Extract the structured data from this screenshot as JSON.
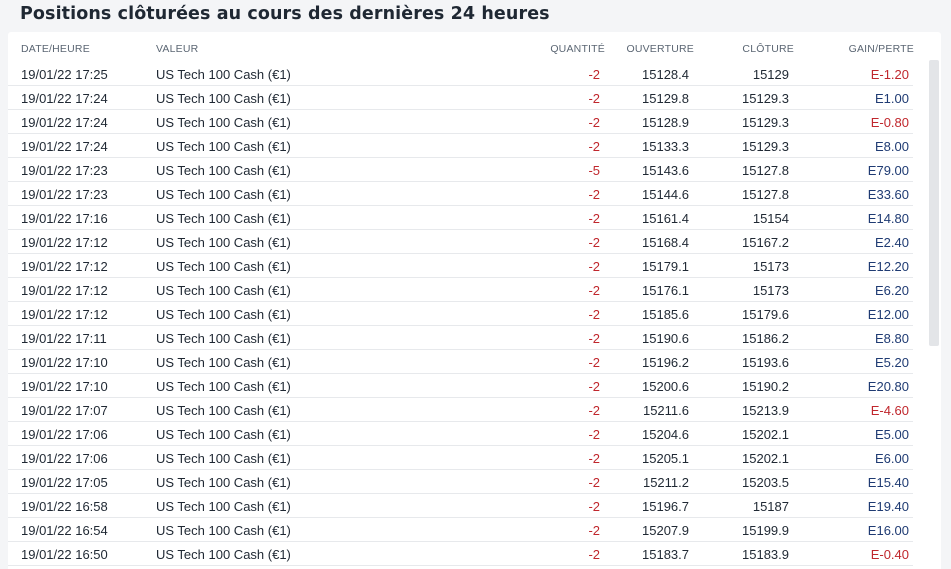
{
  "title": "Positions clôturées au cours des dernières 24 heures",
  "columns": {
    "date": "DATE/HEURE",
    "valeur": "VALEUR",
    "quantite": "QUANTITÉ",
    "ouverture": "OUVERTURE",
    "cloture": "CLÔTURE",
    "gain": "GAIN/PERTE"
  },
  "colors": {
    "negative": "#c0272d",
    "positive": "#1f3b73"
  },
  "rows": [
    {
      "date": "19/01/22 17:25",
      "valeur": "US Tech 100 Cash (€1)",
      "quantite": "-2",
      "ouverture": "15128.4",
      "cloture": "15129",
      "gain": "E-1.20"
    },
    {
      "date": "19/01/22 17:24",
      "valeur": "US Tech 100 Cash (€1)",
      "quantite": "-2",
      "ouverture": "15129.8",
      "cloture": "15129.3",
      "gain": "E1.00"
    },
    {
      "date": "19/01/22 17:24",
      "valeur": "US Tech 100 Cash (€1)",
      "quantite": "-2",
      "ouverture": "15128.9",
      "cloture": "15129.3",
      "gain": "E-0.80"
    },
    {
      "date": "19/01/22 17:24",
      "valeur": "US Tech 100 Cash (€1)",
      "quantite": "-2",
      "ouverture": "15133.3",
      "cloture": "15129.3",
      "gain": "E8.00"
    },
    {
      "date": "19/01/22 17:23",
      "valeur": "US Tech 100 Cash (€1)",
      "quantite": "-5",
      "ouverture": "15143.6",
      "cloture": "15127.8",
      "gain": "E79.00"
    },
    {
      "date": "19/01/22 17:23",
      "valeur": "US Tech 100 Cash (€1)",
      "quantite": "-2",
      "ouverture": "15144.6",
      "cloture": "15127.8",
      "gain": "E33.60"
    },
    {
      "date": "19/01/22 17:16",
      "valeur": "US Tech 100 Cash (€1)",
      "quantite": "-2",
      "ouverture": "15161.4",
      "cloture": "15154",
      "gain": "E14.80"
    },
    {
      "date": "19/01/22 17:12",
      "valeur": "US Tech 100 Cash (€1)",
      "quantite": "-2",
      "ouverture": "15168.4",
      "cloture": "15167.2",
      "gain": "E2.40"
    },
    {
      "date": "19/01/22 17:12",
      "valeur": "US Tech 100 Cash (€1)",
      "quantite": "-2",
      "ouverture": "15179.1",
      "cloture": "15173",
      "gain": "E12.20"
    },
    {
      "date": "19/01/22 17:12",
      "valeur": "US Tech 100 Cash (€1)",
      "quantite": "-2",
      "ouverture": "15176.1",
      "cloture": "15173",
      "gain": "E6.20"
    },
    {
      "date": "19/01/22 17:12",
      "valeur": "US Tech 100 Cash (€1)",
      "quantite": "-2",
      "ouverture": "15185.6",
      "cloture": "15179.6",
      "gain": "E12.00"
    },
    {
      "date": "19/01/22 17:11",
      "valeur": "US Tech 100 Cash (€1)",
      "quantite": "-2",
      "ouverture": "15190.6",
      "cloture": "15186.2",
      "gain": "E8.80"
    },
    {
      "date": "19/01/22 17:10",
      "valeur": "US Tech 100 Cash (€1)",
      "quantite": "-2",
      "ouverture": "15196.2",
      "cloture": "15193.6",
      "gain": "E5.20"
    },
    {
      "date": "19/01/22 17:10",
      "valeur": "US Tech 100 Cash (€1)",
      "quantite": "-2",
      "ouverture": "15200.6",
      "cloture": "15190.2",
      "gain": "E20.80"
    },
    {
      "date": "19/01/22 17:07",
      "valeur": "US Tech 100 Cash (€1)",
      "quantite": "-2",
      "ouverture": "15211.6",
      "cloture": "15213.9",
      "gain": "E-4.60"
    },
    {
      "date": "19/01/22 17:06",
      "valeur": "US Tech 100 Cash (€1)",
      "quantite": "-2",
      "ouverture": "15204.6",
      "cloture": "15202.1",
      "gain": "E5.00"
    },
    {
      "date": "19/01/22 17:06",
      "valeur": "US Tech 100 Cash (€1)",
      "quantite": "-2",
      "ouverture": "15205.1",
      "cloture": "15202.1",
      "gain": "E6.00"
    },
    {
      "date": "19/01/22 17:05",
      "valeur": "US Tech 100 Cash (€1)",
      "quantite": "-2",
      "ouverture": "15211.2",
      "cloture": "15203.5",
      "gain": "E15.40"
    },
    {
      "date": "19/01/22 16:58",
      "valeur": "US Tech 100 Cash (€1)",
      "quantite": "-2",
      "ouverture": "15196.7",
      "cloture": "15187",
      "gain": "E19.40"
    },
    {
      "date": "19/01/22 16:54",
      "valeur": "US Tech 100 Cash (€1)",
      "quantite": "-2",
      "ouverture": "15207.9",
      "cloture": "15199.9",
      "gain": "E16.00"
    },
    {
      "date": "19/01/22 16:50",
      "valeur": "US Tech 100 Cash (€1)",
      "quantite": "-2",
      "ouverture": "15183.7",
      "cloture": "15183.9",
      "gain": "E-0.40"
    }
  ]
}
